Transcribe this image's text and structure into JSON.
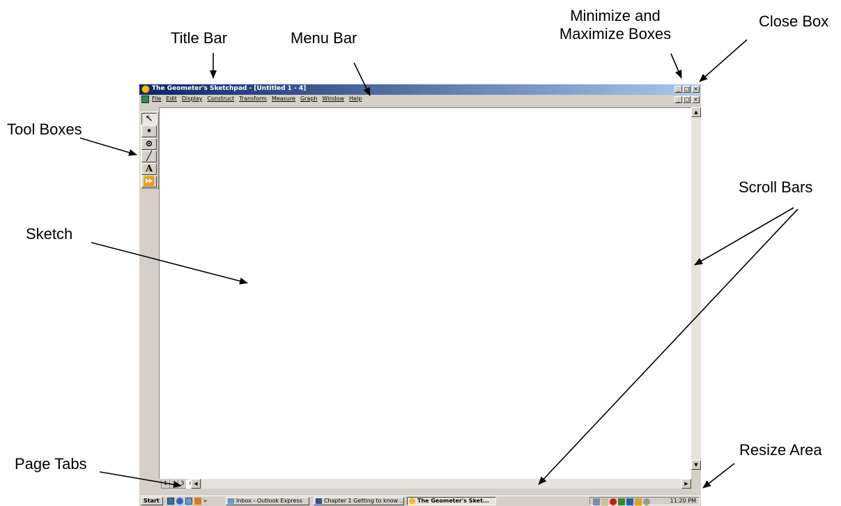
{
  "callouts": {
    "title_bar": "Title Bar",
    "menu_bar": "Menu Bar",
    "minimize_maximize_line1": "Minimize and",
    "minimize_maximize_line2": "Maximize Boxes",
    "close_box": "Close Box",
    "tool_boxes": "Tool Boxes",
    "scroll_bars": "Scroll Bars",
    "sketch": "Sketch",
    "page_tabs": "Page Tabs",
    "resize_area": "Resize Area"
  },
  "window": {
    "title": "The Geometer's Sketchpad - [Untitled 1 - 4]",
    "menus": [
      "File",
      "Edit",
      "Display",
      "Construct",
      "Transform",
      "Measure",
      "Graph",
      "Window",
      "Help"
    ],
    "caption_buttons": [
      "_",
      "□",
      "×"
    ]
  },
  "tools": [
    {
      "name": "selection-arrow-tool",
      "glyph": "↖"
    },
    {
      "name": "point-tool",
      "glyph": "•"
    },
    {
      "name": "compass-tool",
      "glyph": "⊙"
    },
    {
      "name": "straightedge-tool",
      "glyph": "╱"
    },
    {
      "name": "text-tool",
      "glyph": "A"
    },
    {
      "name": "custom-tool",
      "glyph": "⏩"
    }
  ],
  "page_tabs": [
    "1",
    "2",
    "3",
    "4"
  ],
  "active_page_tab": "4",
  "taskbar": {
    "start_label": "Start",
    "quicklaunch_more": "»",
    "buttons": [
      {
        "label": "Inbox - Outlook Express",
        "active": false
      },
      {
        "label": "Chapter 1 Getting to know ...",
        "active": false
      },
      {
        "label": "The Geometer's Sket...",
        "active": true
      }
    ],
    "clock": "11:20 PM"
  },
  "colors": {
    "titlebar_start": "#0a246a",
    "titlebar_end": "#a6caf0",
    "chrome": "#d4d0c8"
  }
}
